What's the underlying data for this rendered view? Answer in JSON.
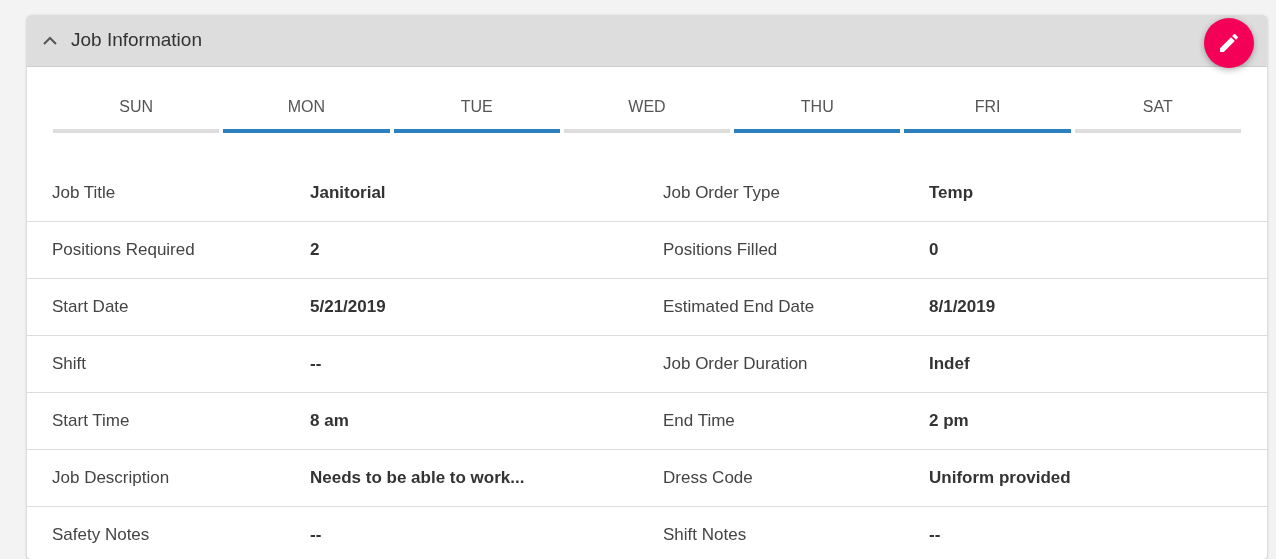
{
  "panel": {
    "title": "Job Information",
    "expanded": true
  },
  "days": [
    {
      "label": "SUN",
      "active": false
    },
    {
      "label": "MON",
      "active": true
    },
    {
      "label": "TUE",
      "active": true
    },
    {
      "label": "WED",
      "active": false
    },
    {
      "label": "THU",
      "active": true
    },
    {
      "label": "FRI",
      "active": true
    },
    {
      "label": "SAT",
      "active": false
    }
  ],
  "rows": [
    {
      "left": {
        "label": "Job Title",
        "value": "Janitorial"
      },
      "right": {
        "label": "Job Order Type",
        "value": "Temp"
      }
    },
    {
      "left": {
        "label": "Positions Required",
        "value": "2"
      },
      "right": {
        "label": "Positions Filled",
        "value": "0"
      }
    },
    {
      "left": {
        "label": "Start Date",
        "value": "5/21/2019"
      },
      "right": {
        "label": "Estimated End Date",
        "value": "8/1/2019"
      }
    },
    {
      "left": {
        "label": "Shift",
        "value": "--"
      },
      "right": {
        "label": "Job Order Duration",
        "value": "Indef"
      }
    },
    {
      "left": {
        "label": "Start Time",
        "value": "8 am"
      },
      "right": {
        "label": "End Time",
        "value": "2 pm"
      }
    },
    {
      "left": {
        "label": "Job Description",
        "value": "Needs to be able to work..."
      },
      "right": {
        "label": "Dress Code",
        "value": "Uniform provided"
      }
    },
    {
      "left": {
        "label": "Safety Notes",
        "value": "--"
      },
      "right": {
        "label": "Shift Notes",
        "value": "--"
      }
    }
  ]
}
